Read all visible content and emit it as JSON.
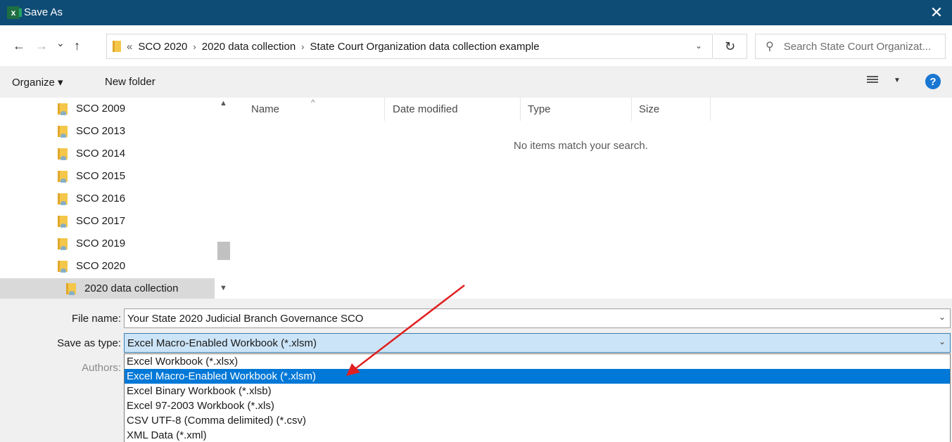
{
  "window": {
    "title": "Save As",
    "app_icon": "excel-icon",
    "close_glyph": "✕"
  },
  "nav": {
    "back": "←",
    "forward": "→",
    "recent": "⌄",
    "up": "↑"
  },
  "address": {
    "overflow": "«",
    "crumbs": [
      "SCO 2020",
      "2020 data collection",
      "State Court Organization data collection example"
    ],
    "separator": "›",
    "dropdown": "⌄",
    "refresh": "↻"
  },
  "search": {
    "placeholder": "Search State Court Organizat..."
  },
  "toolbar": {
    "organize": "Organize ▾",
    "new_folder": "New folder",
    "help": "?"
  },
  "nav_pane": {
    "items": [
      "SCO 2009",
      "SCO 2013",
      "SCO 2014",
      "SCO 2015",
      "SCO 2016",
      "SCO 2017",
      "SCO 2019",
      "SCO 2020",
      "2020 data collection"
    ],
    "selected_index": 8
  },
  "file_list": {
    "columns": [
      "Name",
      "Date modified",
      "Type",
      "Size"
    ],
    "empty_message": "No items match your search."
  },
  "form": {
    "file_name_label": "File name:",
    "file_name_value": "Your State 2020 Judicial Branch Governance SCO",
    "save_type_label": "Save as type:",
    "save_type_value": "Excel Macro-Enabled Workbook (*.xlsm)",
    "authors_label": "Authors:",
    "dropdown_glyph": "⌄"
  },
  "type_options": [
    "Excel Workbook (*.xlsx)",
    "Excel Macro-Enabled Workbook (*.xlsm)",
    "Excel Binary Workbook (*.xlsb)",
    "Excel 97-2003 Workbook (*.xls)",
    "CSV UTF-8 (Comma delimited) (*.csv)",
    "XML Data (*.xml)"
  ],
  "highlighted_option_index": 1,
  "colors": {
    "title_bar": "#0f4c75",
    "highlight": "#0078d7",
    "annotation_arrow": "#e02020"
  }
}
